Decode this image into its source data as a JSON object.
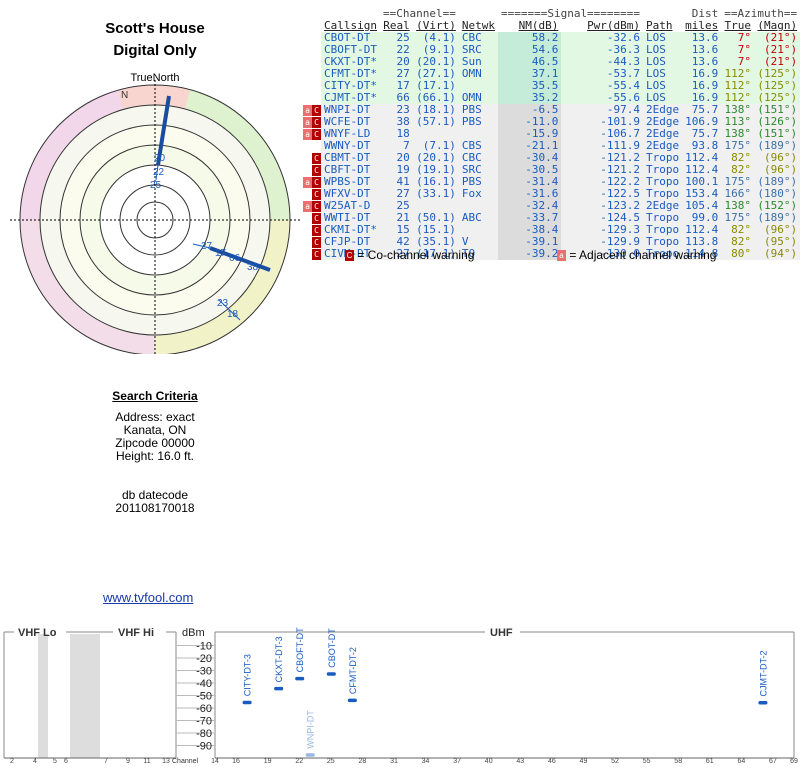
{
  "header": {
    "title_line1": "Scott's House",
    "title_line2": "Digital Only"
  },
  "polar": {
    "true_north_label": "TrueNorth",
    "north_marker": "N",
    "labels": [
      "20",
      "22",
      "25",
      "27",
      "17",
      "66",
      "38",
      "23",
      "18"
    ]
  },
  "criteria": {
    "heading": "Search Criteria",
    "address": "Address: exact",
    "city": "Kanata, ON",
    "zipcode": "Zipcode 00000",
    "height": "Height: 16.0 ft.",
    "db_label": "db datecode",
    "db_value": "201108170018"
  },
  "link": {
    "text": "www.tvfool.com"
  },
  "table": {
    "group_headers": {
      "channel": "==Channel==",
      "signal": "=======Signal========",
      "dist": "Dist",
      "azimuth": "==Azimuth=="
    },
    "columns": [
      "Callsign",
      "Real",
      "(Virt)",
      "Netwk",
      "NM(dB)",
      "Pwr(dBm)",
      "Path",
      "miles",
      "True",
      "(Magn)"
    ],
    "rows": [
      {
        "warn": [],
        "call": "CBOT-DT",
        "real": "25",
        "virt": "(4.1)",
        "net": "CBC",
        "nm": "58.2",
        "pwr": "-32.6",
        "path": "LOS",
        "miles": "13.6",
        "true": "7°",
        "magn": "(21°)",
        "az": "red",
        "bg": "g"
      },
      {
        "warn": [],
        "call": "CBOFT-DT",
        "real": "22",
        "virt": "(9.1)",
        "net": "SRC",
        "nm": "54.6",
        "pwr": "-36.3",
        "path": "LOS",
        "miles": "13.6",
        "true": "7°",
        "magn": "(21°)",
        "az": "red",
        "bg": "g"
      },
      {
        "warn": [],
        "call": "CKXT-DT*",
        "real": "20",
        "virt": "(20.1)",
        "net": "Sun",
        "nm": "46.5",
        "pwr": "-44.3",
        "path": "LOS",
        "miles": "13.6",
        "true": "7°",
        "magn": "(21°)",
        "az": "red",
        "bg": "g"
      },
      {
        "warn": [],
        "call": "CFMT-DT*",
        "real": "27",
        "virt": "(27.1)",
        "net": "OMN",
        "nm": "37.1",
        "pwr": "-53.7",
        "path": "LOS",
        "miles": "16.9",
        "true": "112°",
        "magn": "(125°)",
        "az": "olive",
        "bg": "g"
      },
      {
        "warn": [],
        "call": "CITY-DT*",
        "real": "17",
        "virt": "(17.1)",
        "net": "",
        "nm": "35.5",
        "pwr": "-55.4",
        "path": "LOS",
        "miles": "16.9",
        "true": "112°",
        "magn": "(125°)",
        "az": "olive",
        "bg": "g"
      },
      {
        "warn": [],
        "call": "CJMT-DT*",
        "real": "66",
        "virt": "(66.1)",
        "net": "OMN",
        "nm": "35.2",
        "pwr": "-55.6",
        "path": "LOS",
        "miles": "16.9",
        "true": "112°",
        "magn": "(125°)",
        "az": "olive",
        "bg": "g"
      },
      {
        "warn": [
          "a",
          "C"
        ],
        "call": "WNPI-DT",
        "real": "23",
        "virt": "(18.1)",
        "net": "PBS",
        "nm": "-6.5",
        "pwr": "-97.4",
        "path": "2Edge",
        "miles": "75.7",
        "true": "138°",
        "magn": "(151°)",
        "az": "green",
        "bg": "w"
      },
      {
        "warn": [
          "a",
          "C"
        ],
        "call": "WCFE-DT",
        "real": "38",
        "virt": "(57.1)",
        "net": "PBS",
        "nm": "-11.0",
        "pwr": "-101.9",
        "path": "2Edge",
        "miles": "106.9",
        "true": "113°",
        "magn": "(126°)",
        "az": "green",
        "bg": "w"
      },
      {
        "warn": [
          "a",
          "C"
        ],
        "call": "WNYF-LD",
        "real": "18",
        "virt": "",
        "net": "",
        "nm": "-15.9",
        "pwr": "-106.7",
        "path": "2Edge",
        "miles": "75.7",
        "true": "138°",
        "magn": "(151°)",
        "az": "green",
        "bg": "w"
      },
      {
        "warn": [],
        "call": "WWNY-DT",
        "real": "7",
        "virt": "(7.1)",
        "net": "CBS",
        "nm": "-21.1",
        "pwr": "-111.9",
        "path": "2Edge",
        "miles": "93.8",
        "true": "175°",
        "magn": "(189°)",
        "az": "teal",
        "bg": "w"
      },
      {
        "warn": [
          "C"
        ],
        "call": "CBMT-DT",
        "real": "20",
        "virt": "(20.1)",
        "net": "CBC",
        "nm": "-30.4",
        "pwr": "-121.2",
        "path": "Tropo",
        "miles": "112.4",
        "true": "82°",
        "magn": "(96°)",
        "az": "olive",
        "bg": "w"
      },
      {
        "warn": [
          "C"
        ],
        "call": "CBFT-DT",
        "real": "19",
        "virt": "(19.1)",
        "net": "SRC",
        "nm": "-30.5",
        "pwr": "-121.2",
        "path": "Tropo",
        "miles": "112.4",
        "true": "82°",
        "magn": "(96°)",
        "az": "olive",
        "bg": "w"
      },
      {
        "warn": [
          "a",
          "C"
        ],
        "call": "WPBS-DT",
        "real": "41",
        "virt": "(16.1)",
        "net": "PBS",
        "nm": "-31.4",
        "pwr": "-122.2",
        "path": "Tropo",
        "miles": "100.1",
        "true": "175°",
        "magn": "(189°)",
        "az": "teal",
        "bg": "w"
      },
      {
        "warn": [
          "C"
        ],
        "call": "WFXV-DT",
        "real": "27",
        "virt": "(33.1)",
        "net": "Fox",
        "nm": "-31.6",
        "pwr": "-122.5",
        "path": "Tropo",
        "miles": "153.4",
        "true": "166°",
        "magn": "(180°)",
        "az": "teal",
        "bg": "w"
      },
      {
        "warn": [
          "a",
          "C"
        ],
        "call": "W25AT-D",
        "real": "25",
        "virt": "",
        "net": "",
        "nm": "-32.4",
        "pwr": "-123.2",
        "path": "2Edge",
        "miles": "105.4",
        "true": "138°",
        "magn": "(152°)",
        "az": "green",
        "bg": "w"
      },
      {
        "warn": [
          "C"
        ],
        "call": "WWTI-DT",
        "real": "21",
        "virt": "(50.1)",
        "net": "ABC",
        "nm": "-33.7",
        "pwr": "-124.5",
        "path": "Tropo",
        "miles": "99.0",
        "true": "175°",
        "magn": "(189°)",
        "az": "teal",
        "bg": "w"
      },
      {
        "warn": [
          "C"
        ],
        "call": "CKMI-DT*",
        "real": "15",
        "virt": "(15.1)",
        "net": "",
        "nm": "-38.4",
        "pwr": "-129.3",
        "path": "Tropo",
        "miles": "112.4",
        "true": "82°",
        "magn": "(96°)",
        "az": "olive",
        "bg": "w"
      },
      {
        "warn": [
          "C"
        ],
        "call": "CFJP-DT",
        "real": "42",
        "virt": "(35.1)",
        "net": "V",
        "nm": "-39.1",
        "pwr": "-129.9",
        "path": "Tropo",
        "miles": "113.8",
        "true": "82°",
        "magn": "(95°)",
        "az": "olive",
        "bg": "w"
      },
      {
        "warn": [
          "C"
        ],
        "call": "CIVM-DT",
        "real": "27",
        "virt": "(17.1)",
        "net": "TQ",
        "nm": "-39.2",
        "pwr": "-130.0",
        "path": "Tropo",
        "miles": "114.8",
        "true": "80°",
        "magn": "(94°)",
        "az": "olive",
        "bg": "w"
      }
    ]
  },
  "legend": {
    "co_box": "C",
    "co_text": "= Co-channel warning",
    "adj_box": "a",
    "adj_text": "= Adjacent channel warning"
  },
  "colors": {
    "red": "#c00000",
    "olive": "#8a8a00",
    "green": "#2a8a2a",
    "teal": "#3a6fa8",
    "callsign": "#1a5bbf",
    "bar": "#1a5bbf"
  },
  "spectrum": {
    "sections": [
      "VHF Lo",
      "VHF Hi",
      "UHF"
    ],
    "dbm_label": "dBm",
    "channel_label": "Channel",
    "db_ticks": [
      "-10",
      "-20",
      "-30",
      "-40",
      "-50",
      "-60",
      "-70",
      "-80",
      "-90"
    ],
    "vhf_ticks": [
      "2",
      "4",
      "5",
      "6",
      "7",
      "9",
      "11",
      "13"
    ],
    "uhf_ticks": [
      "14",
      "16",
      "19",
      "22",
      "25",
      "28",
      "31",
      "34",
      "37",
      "40",
      "43",
      "46",
      "49",
      "52",
      "55",
      "58",
      "61",
      "64",
      "67",
      "69"
    ],
    "bars": [
      {
        "label": "CITY-DT-3",
        "channel": 17,
        "dbm": -55.4,
        "faded": false
      },
      {
        "label": "CKXT-DT-3",
        "channel": 20,
        "dbm": -44.3,
        "faded": false
      },
      {
        "label": "CBOFT-DT",
        "channel": 22,
        "dbm": -36.3,
        "faded": false
      },
      {
        "label": "WNPI-DT",
        "channel": 23,
        "dbm": -97.4,
        "faded": true
      },
      {
        "label": "CBOT-DT",
        "channel": 25,
        "dbm": -32.6,
        "faded": false
      },
      {
        "label": "CFMT-DT-2",
        "channel": 27,
        "dbm": -53.7,
        "faded": false
      },
      {
        "label": "CJMT-DT-2",
        "channel": 66,
        "dbm": -55.6,
        "faded": false
      }
    ]
  }
}
